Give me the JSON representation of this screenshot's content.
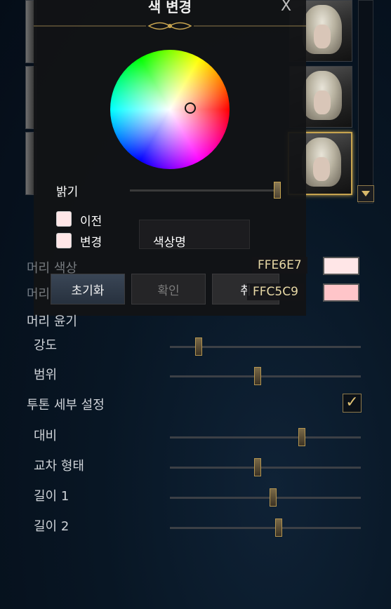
{
  "popup": {
    "title": "색 변경",
    "close": "X",
    "brightness_label": "밝기",
    "brightness": 0.98,
    "previous_label": "이전",
    "changed_label": "변경",
    "color_name_label": "색상명",
    "reset_button": "초기화",
    "confirm_button": "확인",
    "cancel_button": "취"
  },
  "colors": {
    "previous_hex": "FFE6E7",
    "changed_hex": "FFC5C9",
    "previous_swatch": "#FFE6E7",
    "changed_swatch": "#FFC5C9",
    "accent": "#C7A44F"
  },
  "hair_settings": {
    "hair_color_label": "머리 색상",
    "hair_second_label": "머리",
    "gloss_label": "머리 윤기",
    "items": [
      {
        "label": "강도",
        "value": 0.15
      },
      {
        "label": "범위",
        "value": 0.46
      }
    ],
    "twotone_label": "투톤 세부 설정",
    "twotone_checked": true,
    "twotone_items": [
      {
        "label": "대비",
        "value": 0.69
      },
      {
        "label": "교차 형태",
        "value": 0.46
      },
      {
        "label": "길이 1",
        "value": 0.54
      },
      {
        "label": "길이 2",
        "value": 0.57
      }
    ]
  },
  "icons": {
    "check": "check-icon",
    "scroll_down": "chevron-down-icon"
  }
}
